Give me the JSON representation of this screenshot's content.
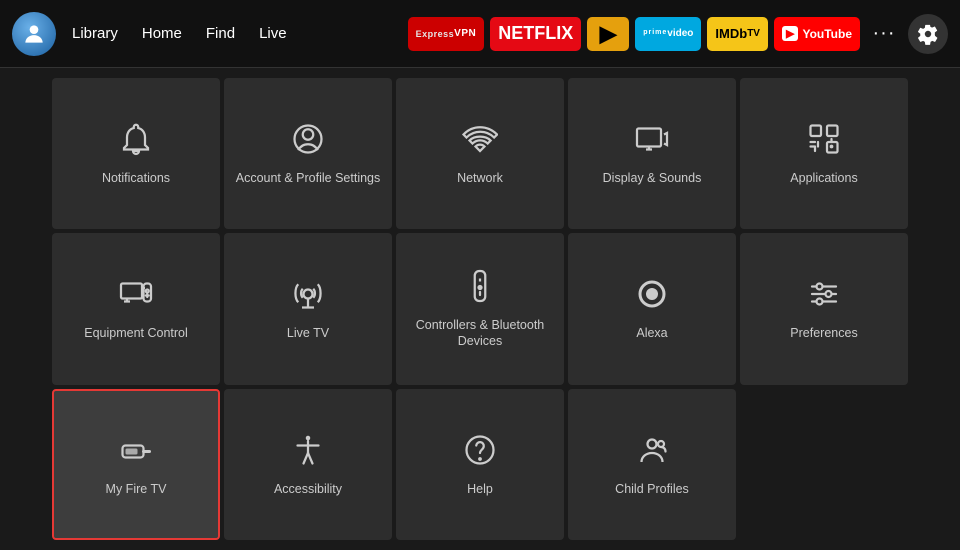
{
  "nav": {
    "links": [
      "Library",
      "Home",
      "Find",
      "Live"
    ],
    "apps": [
      {
        "name": "ExpressVPN",
        "label": "ExpressVPN",
        "class": "app-express"
      },
      {
        "name": "Netflix",
        "label": "NETFLIX",
        "class": "app-netflix"
      },
      {
        "name": "Plex",
        "label": "▶",
        "class": "app-plex"
      },
      {
        "name": "Prime Video",
        "label": "prime video",
        "class": "app-prime"
      },
      {
        "name": "IMDb TV",
        "label": "IMDbTV",
        "class": "app-imdb"
      },
      {
        "name": "YouTube",
        "label": "▶ YouTube",
        "class": "app-youtube"
      }
    ],
    "more_label": "···",
    "settings_label": "Settings"
  },
  "tiles": [
    {
      "id": "notifications",
      "label": "Notifications",
      "icon": "bell",
      "selected": false
    },
    {
      "id": "account-profile",
      "label": "Account & Profile Settings",
      "icon": "person-circle",
      "selected": false
    },
    {
      "id": "network",
      "label": "Network",
      "icon": "wifi",
      "selected": false
    },
    {
      "id": "display-sounds",
      "label": "Display & Sounds",
      "icon": "display-sound",
      "selected": false
    },
    {
      "id": "applications",
      "label": "Applications",
      "icon": "apps-grid",
      "selected": false
    },
    {
      "id": "equipment-control",
      "label": "Equipment Control",
      "icon": "monitor-remote",
      "selected": false
    },
    {
      "id": "live-tv",
      "label": "Live TV",
      "icon": "antenna",
      "selected": false
    },
    {
      "id": "controllers-bluetooth",
      "label": "Controllers & Bluetooth Devices",
      "icon": "remote",
      "selected": false
    },
    {
      "id": "alexa",
      "label": "Alexa",
      "icon": "alexa-ring",
      "selected": false
    },
    {
      "id": "preferences",
      "label": "Preferences",
      "icon": "sliders",
      "selected": false
    },
    {
      "id": "my-fire-tv",
      "label": "My Fire TV",
      "icon": "fire-stick",
      "selected": true
    },
    {
      "id": "accessibility",
      "label": "Accessibility",
      "icon": "accessibility",
      "selected": false
    },
    {
      "id": "help",
      "label": "Help",
      "icon": "question-circle",
      "selected": false
    },
    {
      "id": "child-profiles",
      "label": "Child Profiles",
      "icon": "child-profile",
      "selected": false
    }
  ]
}
